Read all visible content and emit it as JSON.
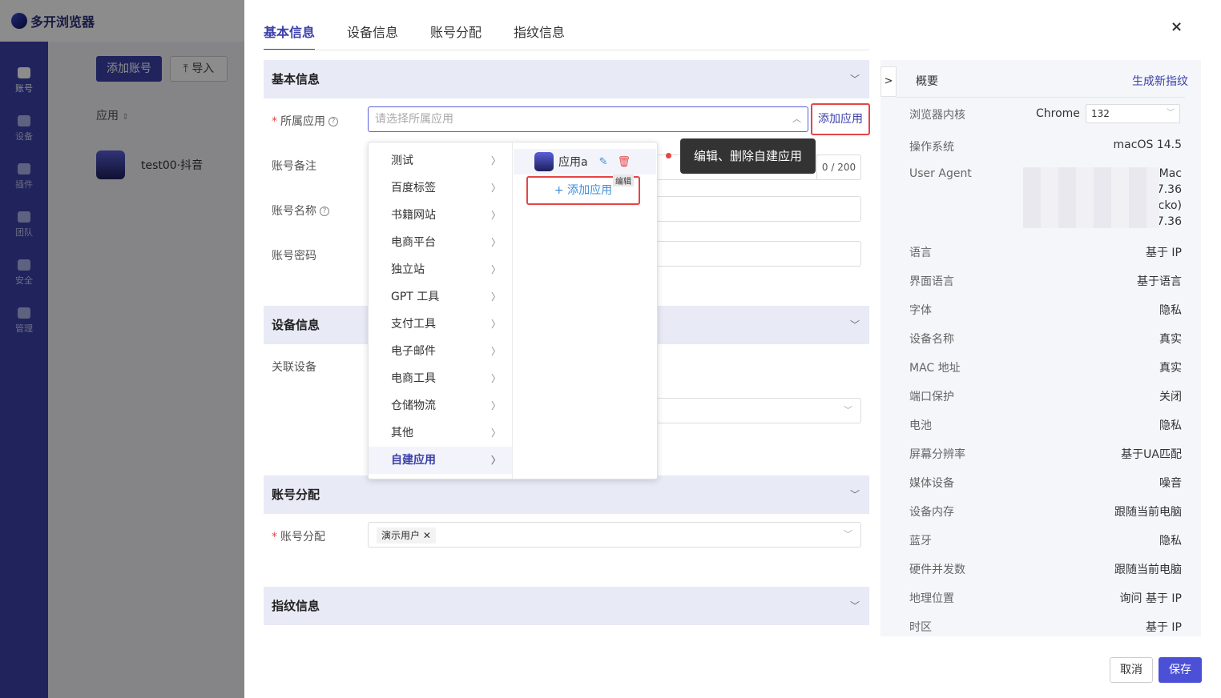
{
  "app": {
    "brand": "多开浏览器",
    "sidebar": [
      "账号",
      "设备",
      "插件",
      "团队",
      "安全",
      "管理"
    ]
  },
  "bg": {
    "add_account": "添加账号",
    "import": "导入",
    "col_app": "应用",
    "row_name": "test00·抖音"
  },
  "drawer": {
    "tabs": [
      "基本信息",
      "设备信息",
      "账号分配",
      "指纹信息"
    ],
    "close": "×",
    "sections": {
      "basic": "基本信息",
      "device": "设备信息",
      "assign": "账号分配",
      "fingerprint": "指纹信息"
    },
    "fields": {
      "app_label": "所属应用",
      "app_placeholder": "请选择所属应用",
      "add_app": "添加应用",
      "remark_label": "账号备注",
      "remark_counter": "0 / 200",
      "name_label": "账号名称",
      "password_label": "账号密码",
      "device_label": "关联设备",
      "assign_label": "账号分配",
      "assign_tag": "演示用户"
    },
    "dropdown": {
      "categories": [
        "测试",
        "百度标签",
        "书籍网站",
        "电商平台",
        "独立站",
        "GPT 工具",
        "支付工具",
        "电子邮件",
        "电商工具",
        "仓储物流",
        "其他",
        "自建应用"
      ],
      "app_item": "应用a",
      "add_app_inline": "+ 添加应用",
      "tooltip_edit": "编辑"
    },
    "callout": "编辑、删除自建应用",
    "right_panel": {
      "toggle": ">",
      "title": "概要",
      "generate": "生成新指纹",
      "kernel_label": "浏览器内核",
      "kernel_value": "Chrome",
      "kernel_version": "132",
      "os_label": "操作系统",
      "os_value": "macOS 14.5",
      "ua_label": "User Agent",
      "ua_lines": [
        "Mo: Mac",
        "OS X 7.36",
        "cko)",
        "Ch 7.36"
      ],
      "rows": [
        {
          "k": "语言",
          "v": "基于 IP"
        },
        {
          "k": "界面语言",
          "v": "基于语言"
        },
        {
          "k": "字体",
          "v": "隐私"
        },
        {
          "k": "设备名称",
          "v": "真实"
        },
        {
          "k": "MAC 地址",
          "v": "真实"
        },
        {
          "k": "端口保护",
          "v": "关闭"
        },
        {
          "k": "电池",
          "v": "隐私"
        },
        {
          "k": "屏幕分辨率",
          "v": "基于UA匹配"
        },
        {
          "k": "媒体设备",
          "v": "噪音"
        },
        {
          "k": "设备内存",
          "v": "跟随当前电脑"
        },
        {
          "k": "蓝牙",
          "v": "隐私"
        },
        {
          "k": "硬件并发数",
          "v": "跟随当前电脑"
        },
        {
          "k": "地理位置",
          "v": "询问 基于 IP"
        },
        {
          "k": "时区",
          "v": "基于 IP"
        }
      ]
    },
    "footer": {
      "cancel": "取消",
      "save": "保存"
    }
  },
  "colors": {
    "primary": "#3b40a8",
    "highlight": "#e54545"
  }
}
